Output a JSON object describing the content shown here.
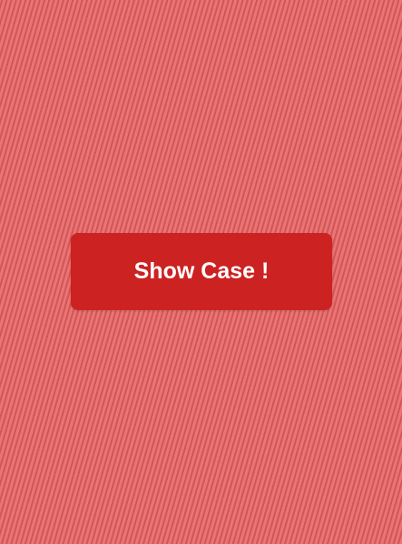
{
  "colors": {
    "background": "#f07272",
    "stripe": "#c85a5a",
    "button_background": "#cc2222",
    "button_text": "#ffffff"
  },
  "main": {
    "show_case_button_label": "Show Case !"
  }
}
